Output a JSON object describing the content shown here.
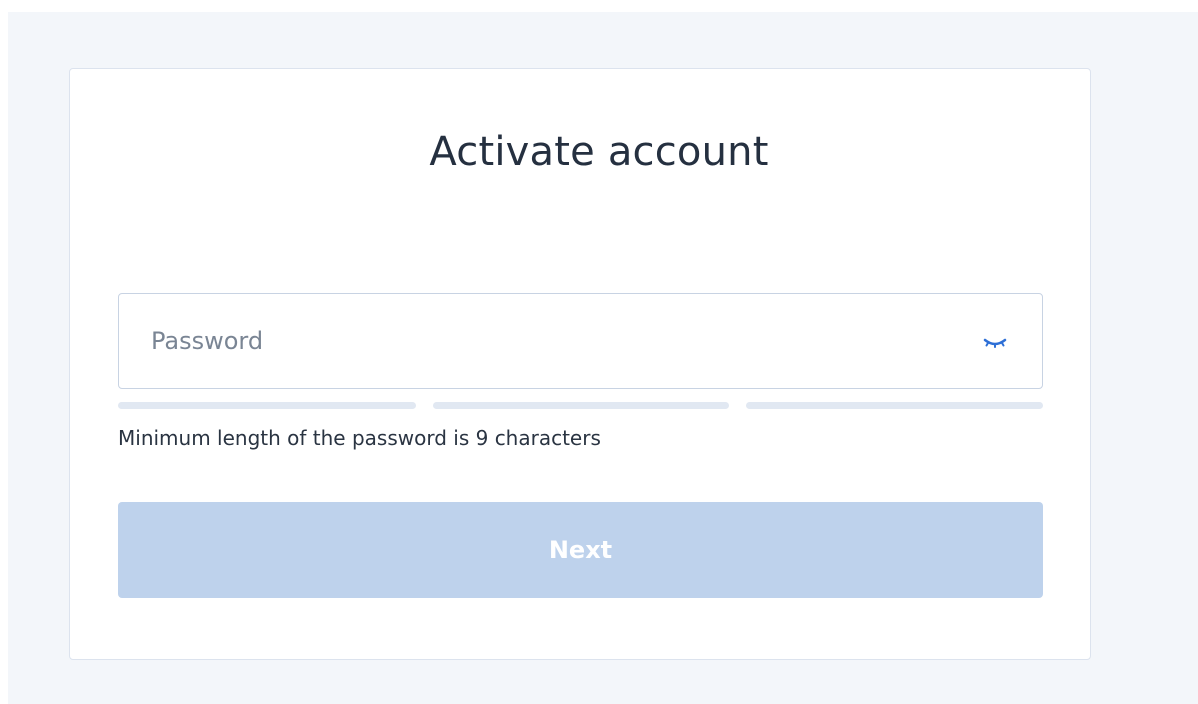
{
  "card": {
    "title": "Activate account"
  },
  "password_field": {
    "placeholder": "Password",
    "value": "",
    "toggle_icon": "eye-closed-icon"
  },
  "strength_meter": {
    "segments": 3,
    "filled": 0
  },
  "hint": {
    "text": "Minimum length of the password is 9 characters"
  },
  "next_button": {
    "label": "Next",
    "enabled": false
  },
  "colors": {
    "background": "#f3f6fa",
    "title": "#253040",
    "accent": "#2e6fd6",
    "button_disabled": "#bed2ec",
    "meter_empty": "#e1e8f2"
  }
}
